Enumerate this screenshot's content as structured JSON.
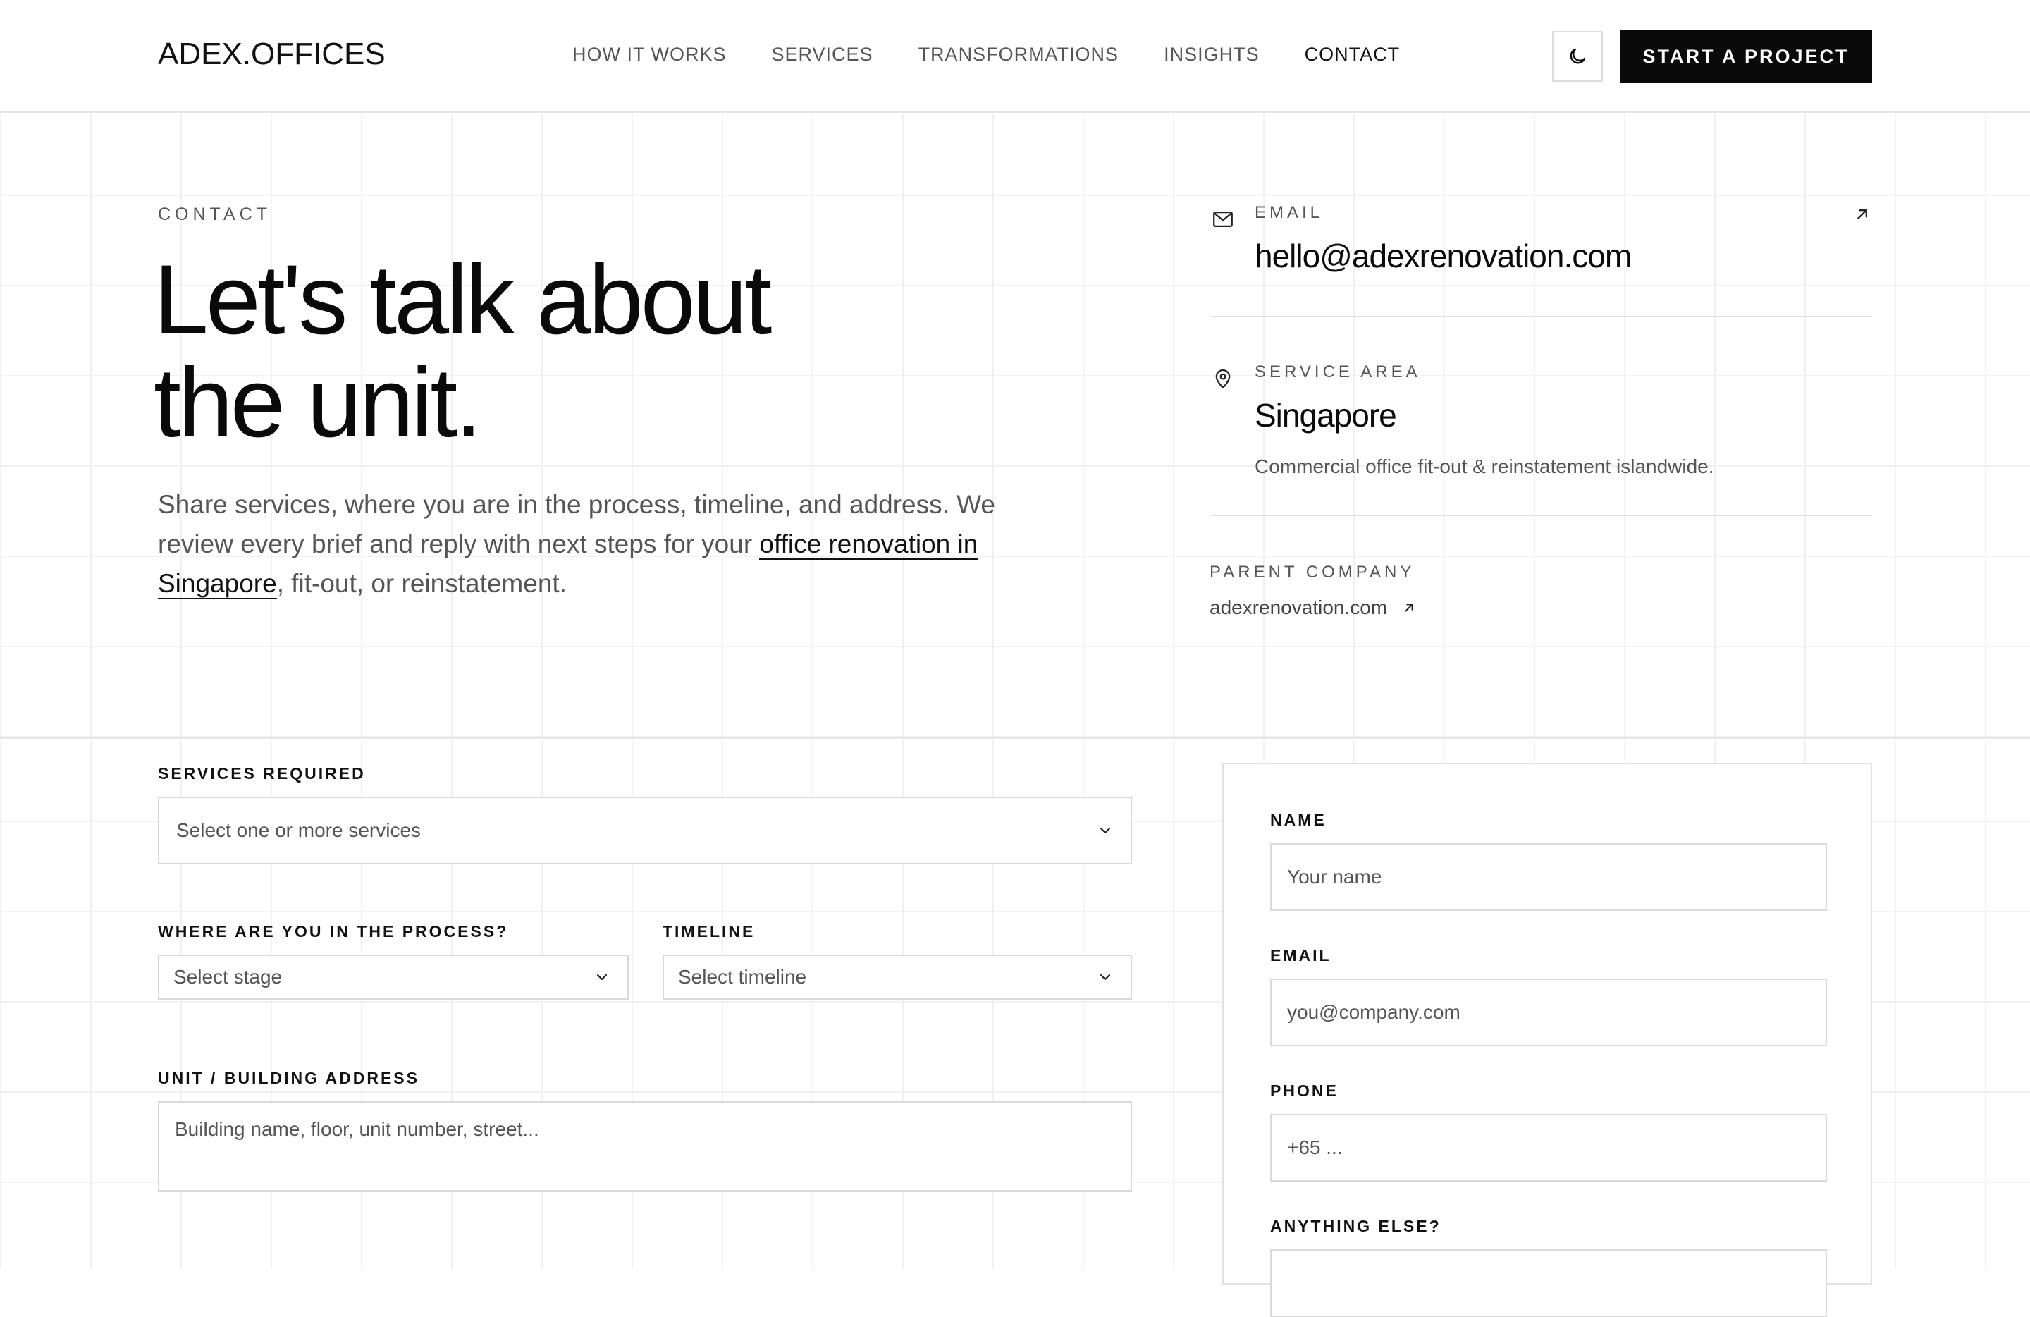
{
  "header": {
    "logo": "ADEX.OFFICES",
    "nav": [
      {
        "label": "HOW IT WORKS"
      },
      {
        "label": "SERVICES"
      },
      {
        "label": "TRANSFORMATIONS"
      },
      {
        "label": "INSIGHTS"
      },
      {
        "label": "CONTACT",
        "active": true
      }
    ],
    "theme_toggle_icon": "moon-icon",
    "cta_label": "START A PROJECT"
  },
  "hero": {
    "eyebrow": "CONTACT",
    "headline_line1": "Let's talk about",
    "headline_line2": "the unit.",
    "lede_before": "Share services, where you are in the process, timeline, and address. We review every brief and reply with next steps for your ",
    "lede_link": "office renovation in Singapore",
    "lede_after": ", fit-out, or reinstatement."
  },
  "info": {
    "email": {
      "icon": "mail-icon",
      "label": "EMAIL",
      "value": "hello@adexrenovation.com",
      "arrow_icon": "arrow-up-right-icon"
    },
    "service_area": {
      "icon": "map-pin-icon",
      "label": "SERVICE AREA",
      "value": "Singapore",
      "sub": "Commercial office fit-out & reinstatement islandwide."
    },
    "parent": {
      "label": "PARENT COMPANY",
      "link": "adexrenovation.com",
      "arrow_icon": "arrow-up-right-icon"
    }
  },
  "form": {
    "services": {
      "label": "SERVICES REQUIRED",
      "placeholder": "Select one or more services"
    },
    "stage": {
      "label": "WHERE ARE YOU IN THE PROCESS?",
      "placeholder": "Select stage"
    },
    "timeline": {
      "label": "TIMELINE",
      "placeholder": "Select timeline"
    },
    "address": {
      "label": "UNIT / BUILDING ADDRESS",
      "placeholder": "Building name, floor, unit number, street..."
    },
    "name": {
      "label": "NAME",
      "placeholder": "Your name"
    },
    "email": {
      "label": "EMAIL",
      "placeholder": "you@company.com"
    },
    "phone": {
      "label": "PHONE",
      "placeholder": "+65 ..."
    },
    "notes": {
      "label": "ANYTHING ELSE?"
    }
  },
  "colors": {
    "accent": "#0a0a0a",
    "border": "#d9d9d9",
    "muted_text": "#555555",
    "grid": "#f1f1f1"
  }
}
